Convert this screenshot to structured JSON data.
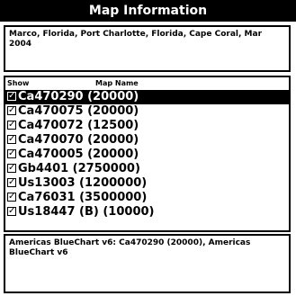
{
  "window": {
    "title": "Map Information"
  },
  "description": {
    "text": "Marco, Florida, Port Charlotte, Florida, Cape Coral, Mar 2004"
  },
  "map_list": {
    "columns": {
      "show": "Show",
      "map_name": "Map Name"
    },
    "rows": [
      {
        "checked": true,
        "label": "Ca470290 (20000)",
        "selected": true
      },
      {
        "checked": true,
        "label": "Ca470075 (20000)",
        "selected": false
      },
      {
        "checked": true,
        "label": "Ca470072 (12500)",
        "selected": false
      },
      {
        "checked": true,
        "label": "Ca470070 (20000)",
        "selected": false
      },
      {
        "checked": true,
        "label": "Ca470005 (20000)",
        "selected": false
      },
      {
        "checked": true,
        "label": "Gb4401 (2750000)",
        "selected": false
      },
      {
        "checked": true,
        "label": "Us13003 (1200000)",
        "selected": false
      },
      {
        "checked": true,
        "label": "Ca76031 (3500000)",
        "selected": false
      },
      {
        "checked": true,
        "label": "Us18447 (B) (10000)",
        "selected": false
      }
    ]
  },
  "status": {
    "text": "Americas BlueChart v6: Ca470290 (20000), Americas BlueChart v6"
  },
  "icons": {
    "checkbox": "checkbox-checked-icon"
  }
}
